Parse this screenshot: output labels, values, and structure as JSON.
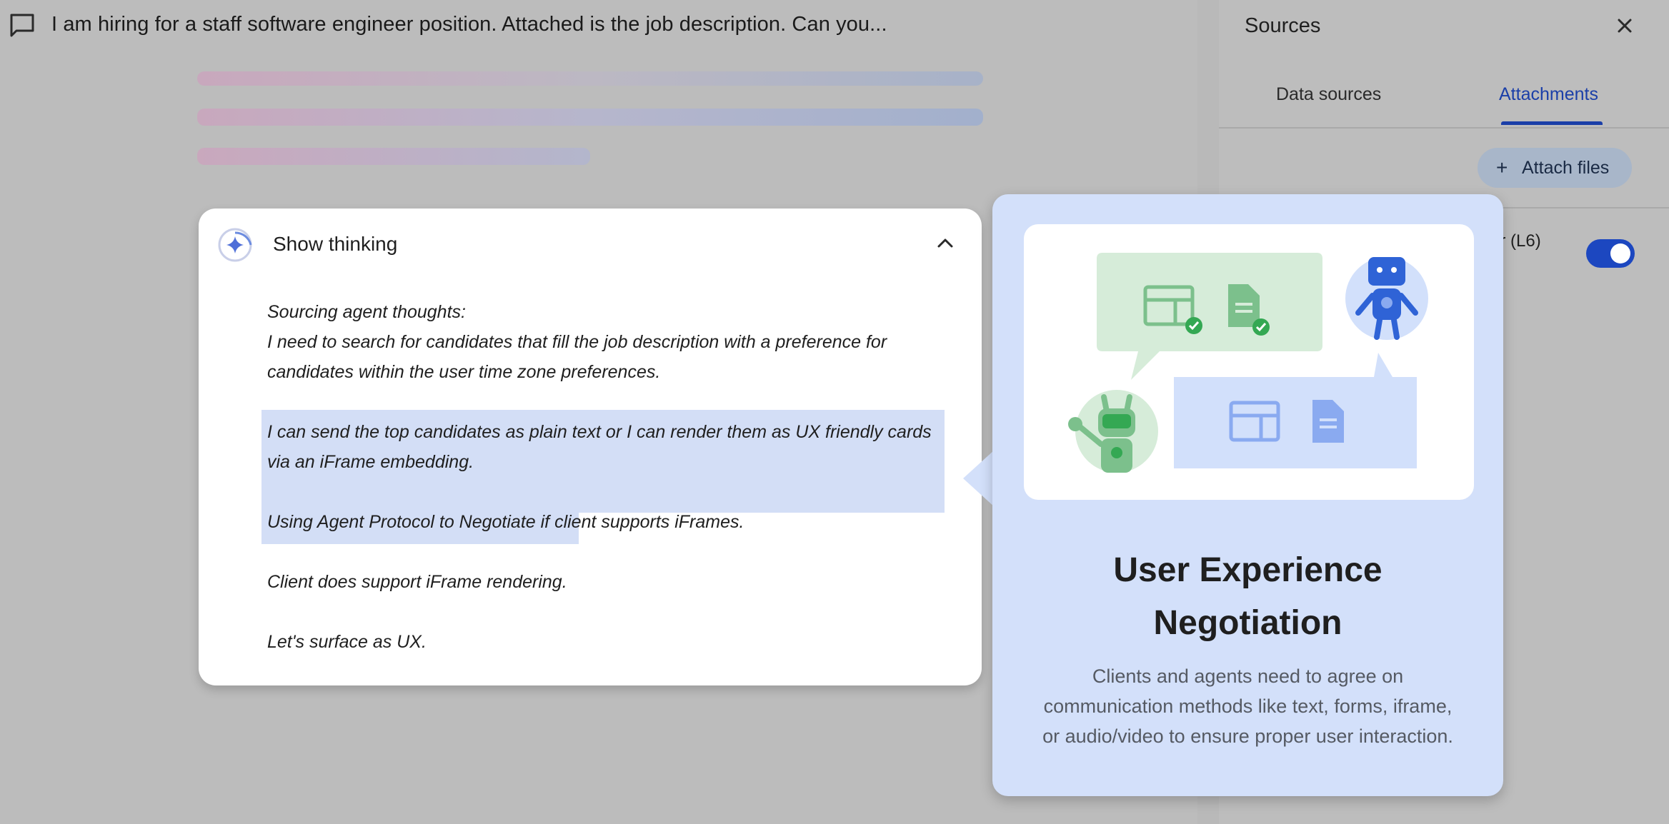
{
  "header": {
    "title": "I am hiring for a staff software engineer position. Attached is the job description. Can you...",
    "icon": "chat-bubble-icon"
  },
  "thinking": {
    "toggle_label": "Show thinking",
    "icon": "spark-icon",
    "lines": [
      "Sourcing agent thoughts:",
      "I need to search for candidates that fill the job description with a preference for",
      "candidates within the user time zone preferences.",
      "I can send the top candidates as plain text or I can render them as UX friendly cards",
      "via an iFrame embedding.",
      "Using Agent Protocol to Negotiate if client supports iFrames.",
      "Client does support iFrame rendering.",
      "Let's surface as UX."
    ]
  },
  "sources": {
    "title": "Sources",
    "tabs": [
      {
        "label": "Data sources",
        "active": false
      },
      {
        "label": "Attachments",
        "active": true
      }
    ],
    "attach_button": "Attach files",
    "row_label": "er (L6)",
    "toggle_on": true,
    "accent": "#1b3fa8"
  },
  "popover": {
    "title_line1": "User Experience",
    "title_line2": "Negotiation",
    "description_line1": "Clients and agents need to agree on",
    "description_line2": "communication methods like text, forms, iframe,",
    "description_line3": "or audio/video to ensure proper user interaction."
  }
}
